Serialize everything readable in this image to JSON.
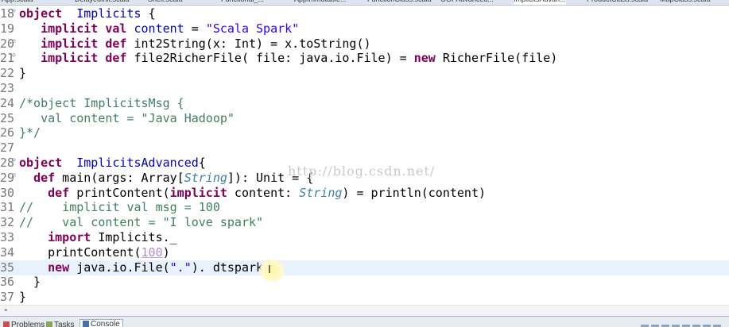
{
  "tabs": [
    {
      "label": "App.scala",
      "active": false
    },
    {
      "label": "DelayedInit.scala",
      "active": false
    },
    {
      "label": "Shell.scala",
      "active": false
    },
    {
      "label": "Functional_...",
      "active": false
    },
    {
      "label": "AppImmutable...",
      "active": false
    },
    {
      "label": "FunctionClass.scala",
      "active": false
    },
    {
      "label": "OOPAdvanced...",
      "active": false
    },
    {
      "label": "ImplicitsAdvan...",
      "active": true
    },
    {
      "label": "ProductClass.scala",
      "active": false
    },
    {
      "label": "MapClass.scala",
      "active": false
    }
  ],
  "editor": {
    "current_line": 35,
    "lines": [
      {
        "n": "18",
        "fold": true,
        "segs": [
          [
            "kw",
            "object"
          ],
          [
            "",
            "  "
          ],
          [
            "fld",
            "Implicits"
          ],
          [
            "",
            " {"
          ]
        ]
      },
      {
        "n": "19",
        "fold": false,
        "segs": [
          [
            "",
            "   "
          ],
          [
            "kw",
            "implicit"
          ],
          [
            "",
            " "
          ],
          [
            "kw",
            "val"
          ],
          [
            "",
            " "
          ],
          [
            "fld",
            "content"
          ],
          [
            "",
            " = "
          ],
          [
            "str",
            "\"Scala Spark\""
          ]
        ]
      },
      {
        "n": "20",
        "fold": true,
        "segs": [
          [
            "",
            "   "
          ],
          [
            "kw",
            "implicit"
          ],
          [
            "",
            " "
          ],
          [
            "kw",
            "def"
          ],
          [
            "",
            " int2String(x: Int) = x.toString()"
          ]
        ]
      },
      {
        "n": "21",
        "fold": true,
        "segs": [
          [
            "",
            "   "
          ],
          [
            "kw",
            "implicit"
          ],
          [
            "",
            " "
          ],
          [
            "kw",
            "def"
          ],
          [
            "",
            " file2RicherFile( file: java.io.File) = "
          ],
          [
            "kw",
            "new"
          ],
          [
            "",
            " RicherFile(file)"
          ]
        ]
      },
      {
        "n": "22",
        "fold": false,
        "segs": [
          [
            "",
            "}"
          ]
        ]
      },
      {
        "n": "23",
        "fold": false,
        "segs": []
      },
      {
        "n": "24",
        "fold": false,
        "segs": [
          [
            "cm",
            "/*object ImplicitsMsg {"
          ]
        ]
      },
      {
        "n": "25",
        "fold": false,
        "segs": [
          [
            "cm",
            "   val content = \"Java Hadoop\""
          ]
        ]
      },
      {
        "n": "26",
        "fold": false,
        "segs": [
          [
            "cm",
            "}*/"
          ]
        ]
      },
      {
        "n": "27",
        "fold": false,
        "segs": []
      },
      {
        "n": "28",
        "fold": true,
        "segs": [
          [
            "kw",
            "object"
          ],
          [
            "",
            "  "
          ],
          [
            "fld",
            "ImplicitsAdvanced"
          ],
          [
            "",
            "{"
          ]
        ]
      },
      {
        "n": "29",
        "fold": true,
        "segs": [
          [
            "",
            "  "
          ],
          [
            "kw",
            "def"
          ],
          [
            "",
            " main(args: Array["
          ],
          [
            "ty",
            "String"
          ],
          [
            "",
            "]): Unit = {"
          ]
        ]
      },
      {
        "n": "30",
        "fold": false,
        "segs": [
          [
            "",
            "    "
          ],
          [
            "kw",
            "def"
          ],
          [
            "",
            " printContent("
          ],
          [
            "kw",
            "implicit"
          ],
          [
            "",
            " content: "
          ],
          [
            "ty",
            "String"
          ],
          [
            "",
            ") = println(content)"
          ]
        ]
      },
      {
        "n": "31",
        "fold": false,
        "segs": [
          [
            "cm",
            "//    implicit val msg = 100"
          ]
        ]
      },
      {
        "n": "32",
        "fold": false,
        "segs": [
          [
            "cm",
            "//    val content = \"I love spark\""
          ]
        ]
      },
      {
        "n": "33",
        "fold": false,
        "segs": [
          [
            "",
            "    "
          ],
          [
            "kw",
            "import"
          ],
          [
            "",
            " Implicits._"
          ]
        ]
      },
      {
        "n": "34",
        "fold": false,
        "segs": [
          [
            "",
            "    printContent("
          ],
          [
            "num",
            "100"
          ],
          [
            "",
            ")"
          ]
        ]
      },
      {
        "n": "35",
        "fold": false,
        "segs": [
          [
            "",
            "    "
          ],
          [
            "kw",
            "new"
          ],
          [
            "",
            " java.io.File("
          ],
          [
            "str",
            "\".\""
          ],
          [
            "",
            "). dtspark"
          ]
        ]
      },
      {
        "n": "36",
        "fold": false,
        "segs": [
          [
            "",
            "  }"
          ]
        ]
      },
      {
        "n": "37",
        "fold": false,
        "segs": [
          [
            "",
            "}"
          ]
        ]
      }
    ]
  },
  "watermark": "http://blog.csdn.net/",
  "bottom_panel": {
    "tabs": [
      "Problems",
      "Tasks",
      "Console"
    ],
    "active_tab": "Console"
  },
  "colors": {
    "keyword": "#7f0055",
    "string": "#2a00ff",
    "comment": "#3f7f5f",
    "field": "#0000c0",
    "current_line_bg": "#e8f2fe"
  }
}
